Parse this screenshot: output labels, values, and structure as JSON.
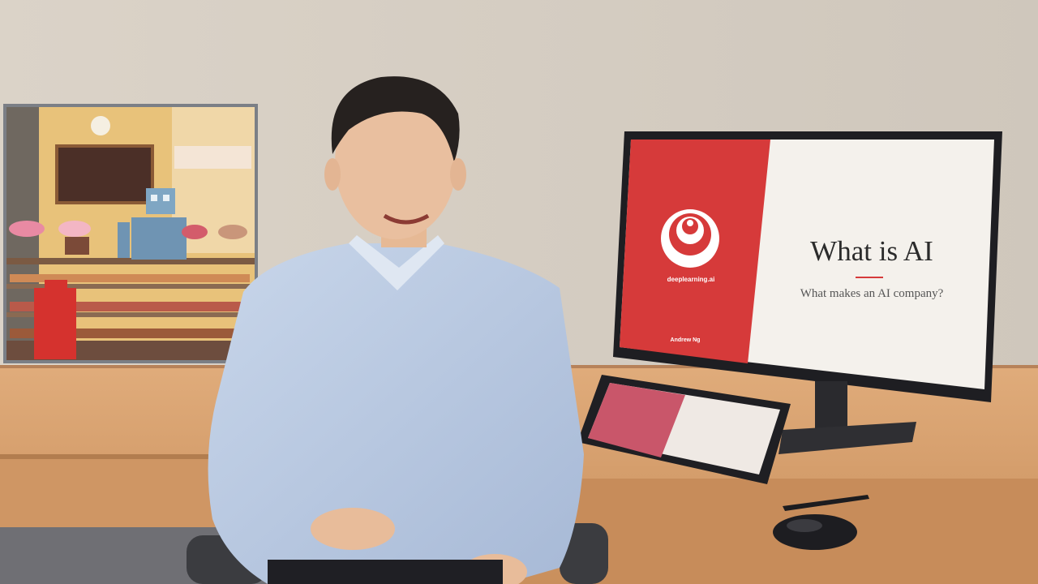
{
  "slide": {
    "title": "What is AI",
    "subtitle": "What makes an AI company?",
    "brand": "deeplearning.ai",
    "author": "Andrew Ng",
    "accent_color": "#d63a3a"
  },
  "scene": {
    "wall_color": "#d9d2c8",
    "desk_color": "#d9a473",
    "shirt_color": "#b9c9e2"
  }
}
